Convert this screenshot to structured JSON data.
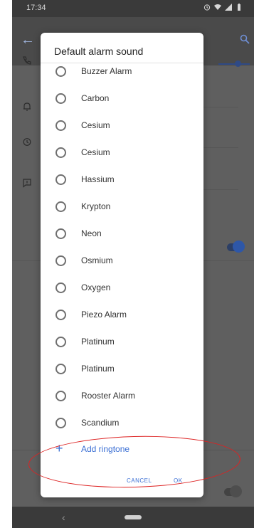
{
  "status_bar": {
    "time": "17:34",
    "icons": [
      "alarm-icon",
      "wifi-icon",
      "signal-icon",
      "battery-icon"
    ]
  },
  "background": {
    "icons": [
      "back-arrow-icon",
      "search-icon",
      "phone-icon",
      "bell-icon",
      "alarm-clock-icon",
      "message-icon"
    ],
    "accent_color": "#2e57a8"
  },
  "dialog": {
    "title": "Default alarm sound",
    "options": [
      {
        "label": "Buzzer Alarm",
        "selected": false
      },
      {
        "label": "Carbon",
        "selected": false
      },
      {
        "label": "Cesium",
        "selected": false
      },
      {
        "label": "Cesium",
        "selected": false
      },
      {
        "label": "Hassium",
        "selected": false
      },
      {
        "label": "Krypton",
        "selected": false
      },
      {
        "label": "Neon",
        "selected": false
      },
      {
        "label": "Osmium",
        "selected": false
      },
      {
        "label": "Oxygen",
        "selected": false
      },
      {
        "label": "Piezo Alarm",
        "selected": false
      },
      {
        "label": "Platinum",
        "selected": false
      },
      {
        "label": "Platinum",
        "selected": false
      },
      {
        "label": "Rooster Alarm",
        "selected": false
      },
      {
        "label": "Scandium",
        "selected": false
      }
    ],
    "add_ringtone": {
      "icon": "plus-icon",
      "label": "Add ringtone"
    },
    "buttons": {
      "cancel": "CANCEL",
      "ok": "OK"
    },
    "link_color": "#3b6fd4"
  },
  "nav_bar": {
    "icons": [
      "nav-back-icon",
      "home-pill-icon"
    ]
  },
  "annotation": {
    "color": "#dd2222",
    "shape": "ellipse"
  }
}
